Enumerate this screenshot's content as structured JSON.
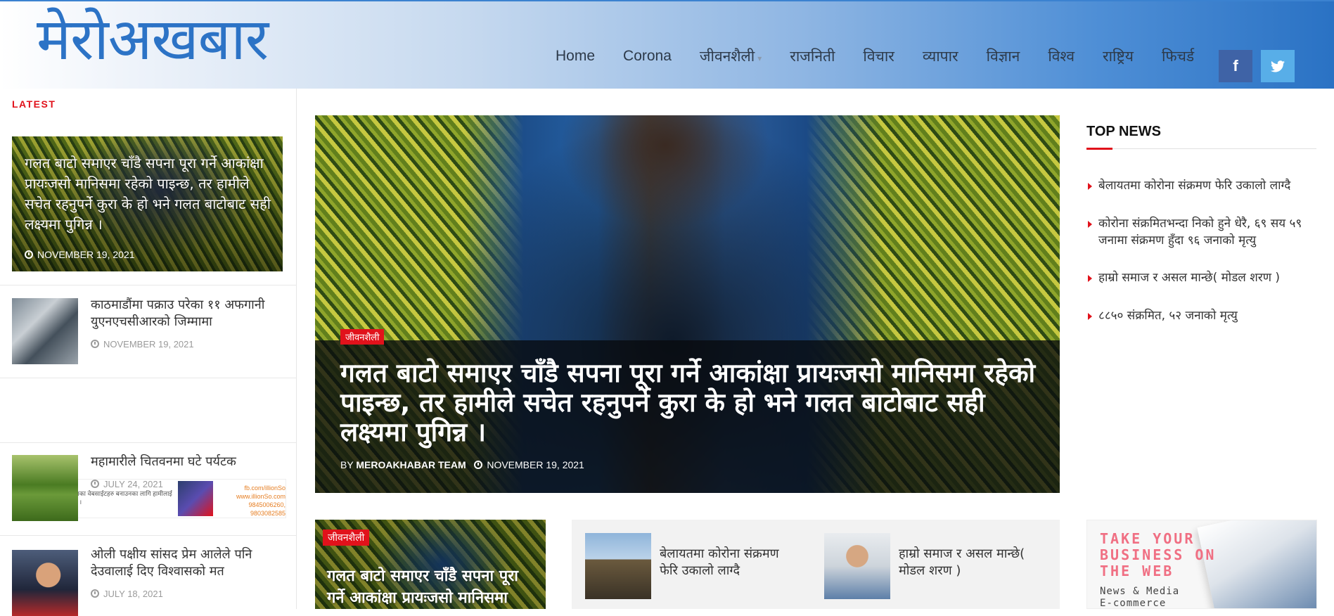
{
  "site": {
    "logo": "मेरोअखबार"
  },
  "nav": {
    "items": [
      "Home",
      "Corona",
      "जीवनशैली",
      "राजनिती",
      "विचार",
      "व्यापार",
      "विज्ञान",
      "विश्व",
      "राष्ट्रिय",
      "फिचर्ड"
    ],
    "facebook_glyph": "f"
  },
  "latest": {
    "label": "LATEST",
    "hero": {
      "title": "गलत बाटो समाएर चाँडै सपना पूरा गर्ने आकांक्षा प्रायःजसो मानिसमा रहेको पाइन्छ, तर हामीले सचेत रहनुपर्ने कुरा के हो भने गलत बाटोबाट सही लक्ष्यमा पुगिन्न ।",
      "date": "NOVEMBER 19, 2021"
    },
    "items": [
      {
        "title": "काठमाडौंमा पक्राउ परेका ११ अफगानी युएनएचसीआरको जिम्मामा",
        "date": "NOVEMBER 19, 2021"
      },
      {
        "title": "महामारीले चितवनमा घटे पर्यटक",
        "date": "JULY 24, 2021"
      },
      {
        "title": "ओली पक्षीय सांसद प्रेम आलेले पनि देउवालाई दिए विश्वासको मत",
        "date": "JULY 18, 2021"
      }
    ],
    "banner": {
      "logo": "illionSo",
      "text": "सबै किसिमका वेबसाईटहरु बनाउनका लागि हामीलाई सम्झनुहोस ।",
      "contact_1": "fb.com/illionSo",
      "contact_2": "www.illionSo.com",
      "contact_3": "9845006260, 9803082585"
    }
  },
  "featured": {
    "category": "जीवनशैली",
    "title": "गलत बाटो समाएर चाँडै सपना पूरा गर्ने आकांक्षा प्रायःजसो मानिसमा रहेको पाइन्छ, तर हामीले सचेत रहनुपर्ने कुरा के हो भने गलत बाटोबाट सही लक्ष्यमा पुगिन्न ।",
    "by_prefix": "BY",
    "author": "MEROAKHABAR TEAM",
    "date": "NOVEMBER 19, 2021"
  },
  "sub_card": {
    "category": "जीवनशैली",
    "title": "गलत बाटो समाएर चाँडै सपना पूरा गर्ने आकांक्षा प्रायःजसो मानिसमा"
  },
  "grid": [
    {
      "title": "बेलायतमा कोरोना संक्रमण फेरि उकालो लाग्दै"
    },
    {
      "title": "हाम्रो समाज र असल मान्छे( मोडल शरण )"
    }
  ],
  "top_news": {
    "heading": "TOP NEWS",
    "items": [
      "बेलायतमा कोरोना संक्रमण फेरि उकालो लाग्दै",
      "कोरोना संक्रमितभन्दा निको हुने धेरै, ६९ सय ५९ जनामा संक्रमण हुँदा ९६ जनाको मृत्यु",
      "हाम्रो समाज र असल मान्छे( मोडल शरण )",
      "८८५० संक्रमित, ५२ जनाको मृत्यु"
    ]
  },
  "ad": {
    "headline": "TAKE YOUR BUSINESS ON THE WEB",
    "line_1": "News & Media",
    "line_2": "E-commerce"
  },
  "colors": {
    "brand": "#2c73c6",
    "accent": "#e1121b",
    "facebook": "#3f63a6",
    "twitter": "#58aee8"
  }
}
